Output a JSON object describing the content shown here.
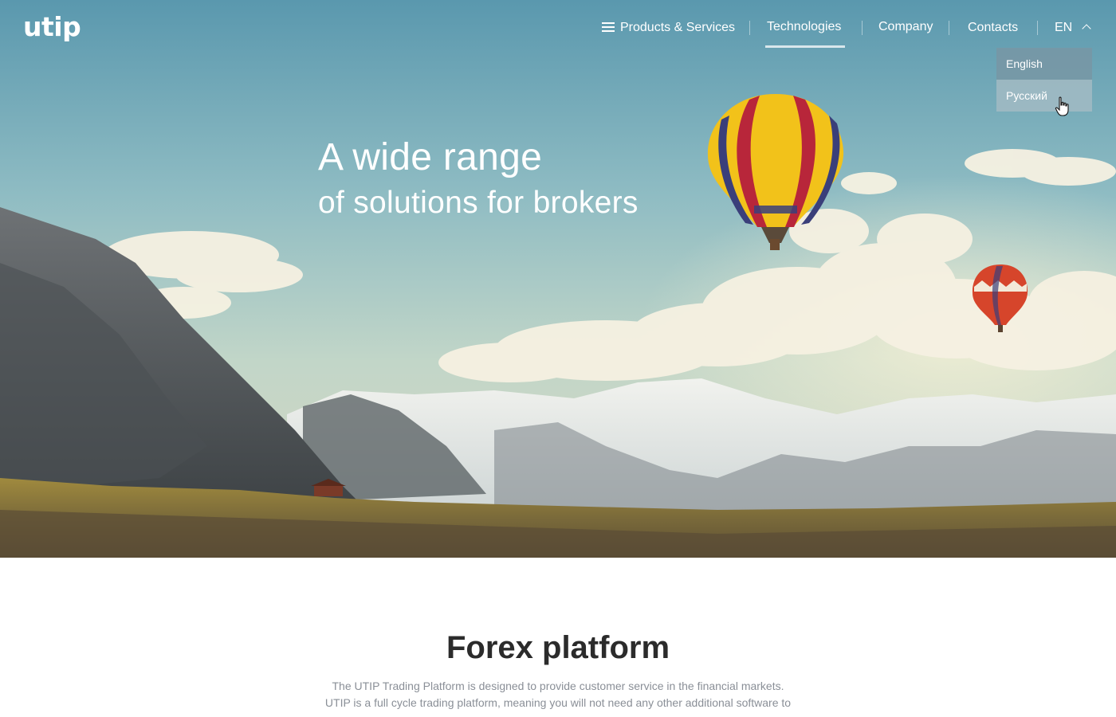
{
  "brand": {
    "logo_text": "utip"
  },
  "nav": {
    "products_label": "Products & Services",
    "technologies_label": "Technologies",
    "company_label": "Company",
    "contacts_label": "Contacts",
    "lang_label": "EN",
    "active_item": "Technologies"
  },
  "language_menu": {
    "options": [
      "English",
      "Русский"
    ],
    "hovered": "Русский"
  },
  "hero": {
    "headline_line1": "A wide range",
    "headline_line2": "of solutions for brokers"
  },
  "section": {
    "title": "Forex platform",
    "text_line1": "The UTIP Trading Platform is designed to provide customer service in the financial markets.",
    "text_line2": "UTIP is a full cycle trading platform, meaning you will not need any other additional software to"
  },
  "icons": [
    "hamburger-icon",
    "chevron-up-icon",
    "hand-pointer-icon"
  ]
}
